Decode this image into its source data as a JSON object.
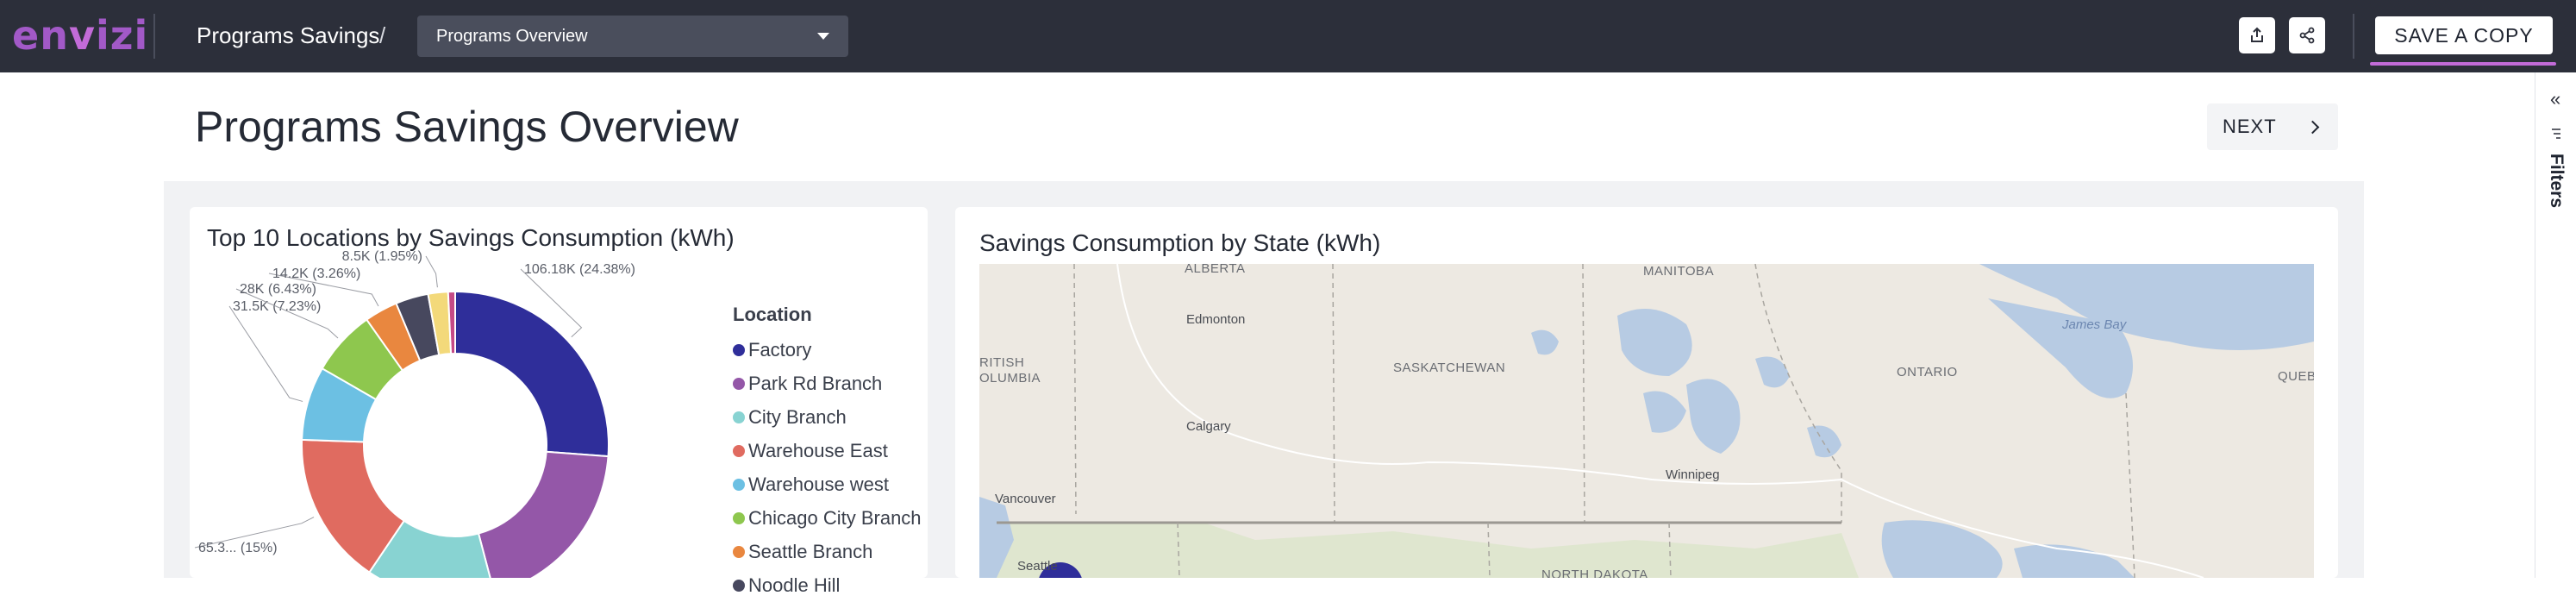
{
  "brand": {
    "logo_text_a": "en",
    "logo_text_b": "v",
    "logo_text_c": "izi",
    "accent": "#c26bd8"
  },
  "nav": {
    "breadcrumb": "Programs Savings",
    "separator": "/",
    "report_select": "Programs Overview",
    "export_icon": "export-icon",
    "share_icon": "share-icon",
    "save_label": "SAVE A COPY"
  },
  "page": {
    "title": "Programs Savings Overview",
    "next_label": "NEXT"
  },
  "filters": {
    "collapse_glyph": "«",
    "label": "Filters"
  },
  "pie_card": {
    "title": "Top 10 Locations by Savings Consumption (kWh)",
    "legend_title": "Location",
    "legend": [
      {
        "label": "Factory",
        "color": "#2f2e9a"
      },
      {
        "label": "Park Rd Branch",
        "color": "#9457a8"
      },
      {
        "label": "City Branch",
        "color": "#88d3d2"
      },
      {
        "label": "Warehouse East",
        "color": "#e06b60"
      },
      {
        "label": "Warehouse west",
        "color": "#6cc0e3"
      },
      {
        "label": "Chicago City Branch",
        "color": "#8ec74e"
      },
      {
        "label": "Seattle Branch",
        "color": "#e9873f"
      },
      {
        "label": "Noodle Hill",
        "color": "#47485e"
      }
    ]
  },
  "chart_data": {
    "type": "pie",
    "title": "Top 10 Locations by Savings Consumption (kWh)",
    "legend_title": "Location",
    "slices": [
      {
        "label": "Factory",
        "value": 106.18,
        "percent": 24.38,
        "display": "106.18K (24.38%)",
        "color": "#2f2e9a"
      },
      {
        "label": "Park Rd Branch",
        "value": 80.0,
        "percent": 18.4,
        "display": "",
        "color": "#9457a8"
      },
      {
        "label": "City Branch",
        "value": 55.0,
        "percent": 12.6,
        "display": "",
        "color": "#88d3d2"
      },
      {
        "label": "Warehouse East",
        "value": 65.3,
        "percent": 15.0,
        "display": "65.3... (15%)",
        "color": "#e06b60"
      },
      {
        "label": "Warehouse west",
        "value": 31.5,
        "percent": 7.23,
        "display": "31.5K (7.23%)",
        "color": "#6cc0e3"
      },
      {
        "label": "Chicago City Branch",
        "value": 28.0,
        "percent": 6.43,
        "display": "28K (6.43%)",
        "color": "#8ec74e"
      },
      {
        "label": "Seattle Branch",
        "value": 14.2,
        "percent": 3.26,
        "display": "14.2K (3.26%)",
        "color": "#e9873f"
      },
      {
        "label": "Noodle Hill",
        "value": 14.0,
        "percent": 3.2,
        "display": "",
        "color": "#47485e"
      },
      {
        "label": "",
        "value": 8.5,
        "percent": 1.95,
        "display": "8.5K (1.95%)",
        "color": "#f3d97a"
      },
      {
        "label": "",
        "value": 3.0,
        "percent": 0.7,
        "display": "",
        "color": "#c54a86"
      }
    ],
    "legend_placement": "right"
  },
  "map_card": {
    "title": "Savings Consumption by State (kWh)",
    "regions": [
      "ALBERTA",
      "MANITOBA",
      "SASKATCHEWAN",
      "ONTARIO",
      "QUEBE",
      "RITISH",
      "OLUMBIA",
      "NORTH DAKOTA"
    ],
    "cities": [
      "Edmonton",
      "Calgary",
      "Winnipeg",
      "Vancouver",
      "Seattle"
    ],
    "water": [
      "James Bay"
    ]
  }
}
